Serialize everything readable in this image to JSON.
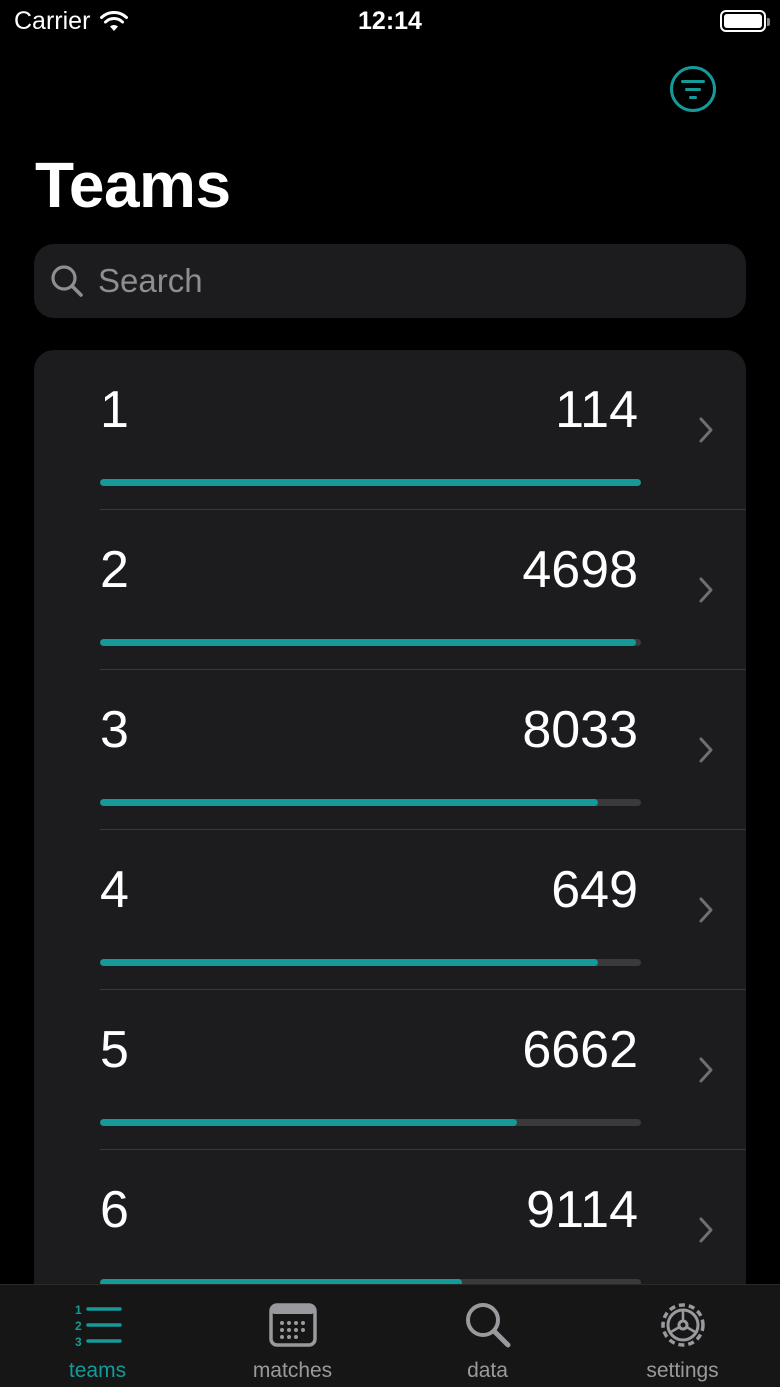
{
  "status_bar": {
    "carrier": "Carrier",
    "time": "12:14"
  },
  "header": {
    "title": "Teams"
  },
  "search": {
    "placeholder": "Search"
  },
  "teams": [
    {
      "number": "1",
      "score": "114",
      "progress": 1.0
    },
    {
      "number": "2",
      "score": "4698",
      "progress": 0.99
    },
    {
      "number": "3",
      "score": "8033",
      "progress": 0.92
    },
    {
      "number": "4",
      "score": "649",
      "progress": 0.92
    },
    {
      "number": "5",
      "score": "6662",
      "progress": 0.77
    },
    {
      "number": "6",
      "score": "9114",
      "progress": 0.67
    }
  ],
  "tabs": [
    {
      "label": "teams",
      "icon": "numbered-list-icon",
      "active": true
    },
    {
      "label": "matches",
      "icon": "calendar-icon",
      "active": false
    },
    {
      "label": "data",
      "icon": "search-icon",
      "active": false
    },
    {
      "label": "settings",
      "icon": "gear-icon",
      "active": false
    }
  ],
  "colors": {
    "accent": "#149a98",
    "background": "#000000",
    "card": "#1c1c1e",
    "track": "#3a3a3c"
  }
}
